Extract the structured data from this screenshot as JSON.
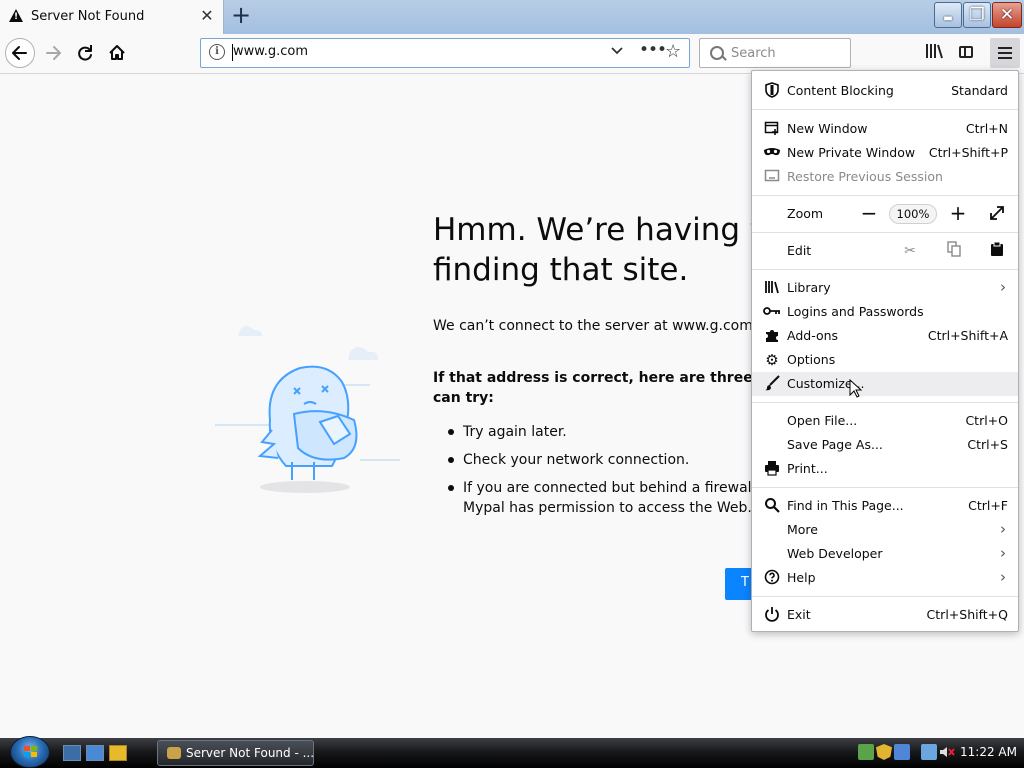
{
  "window": {
    "tab_title": "Server Not Found",
    "close_tab_glyph": "✕",
    "new_tab_glyph": "+",
    "minimize_glyph": "▬",
    "maximize_glyph": "❐",
    "close_glyph": "✕"
  },
  "navbar": {
    "url": "www.g.com",
    "search_placeholder": "Search"
  },
  "error_page": {
    "heading_line1": "Hmm. We’re having tr",
    "heading_line2": "finding that site.",
    "description": "We can’t connect to the server at www.g.com.",
    "bold_line1": "If that address is correct, here are three other",
    "bold_line2": "can try:",
    "suggestions": [
      "Try again later.",
      "Check your network connection.",
      "If you are connected but behind a firewall, c"
    ],
    "suggestion3_line2": "Mypal has permission to access the Web.",
    "try_again_label": "T"
  },
  "menu": {
    "content_blocking": {
      "label": "Content Blocking",
      "value": "Standard"
    },
    "new_window": {
      "label": "New Window",
      "shortcut": "Ctrl+N"
    },
    "new_private_window": {
      "label": "New Private Window",
      "shortcut": "Ctrl+Shift+P"
    },
    "restore_session": {
      "label": "Restore Previous Session"
    },
    "zoom": {
      "label": "Zoom",
      "minus": "−",
      "value": "100%",
      "plus": "+"
    },
    "edit": {
      "label": "Edit"
    },
    "library": {
      "label": "Library"
    },
    "logins": {
      "label": "Logins and Passwords"
    },
    "addons": {
      "label": "Add-ons",
      "shortcut": "Ctrl+Shift+A"
    },
    "options": {
      "label": "Options"
    },
    "customize": {
      "label": "Customize..."
    },
    "open_file": {
      "label": "Open File...",
      "shortcut": "Ctrl+O"
    },
    "save_page": {
      "label": "Save Page As...",
      "shortcut": "Ctrl+S"
    },
    "print": {
      "label": "Print..."
    },
    "find": {
      "label": "Find in This Page...",
      "shortcut": "Ctrl+F"
    },
    "more": {
      "label": "More"
    },
    "web_developer": {
      "label": "Web Developer"
    },
    "help": {
      "label": "Help"
    },
    "exit": {
      "label": "Exit",
      "shortcut": "Ctrl+Shift+Q"
    }
  },
  "taskbar": {
    "task_label": "Server Not Found - ...",
    "clock": "11:22 AM"
  },
  "colors": {
    "accent": "#0a84ff",
    "page_bg": "#f9f9fa",
    "illustration": "#45a1ff"
  }
}
